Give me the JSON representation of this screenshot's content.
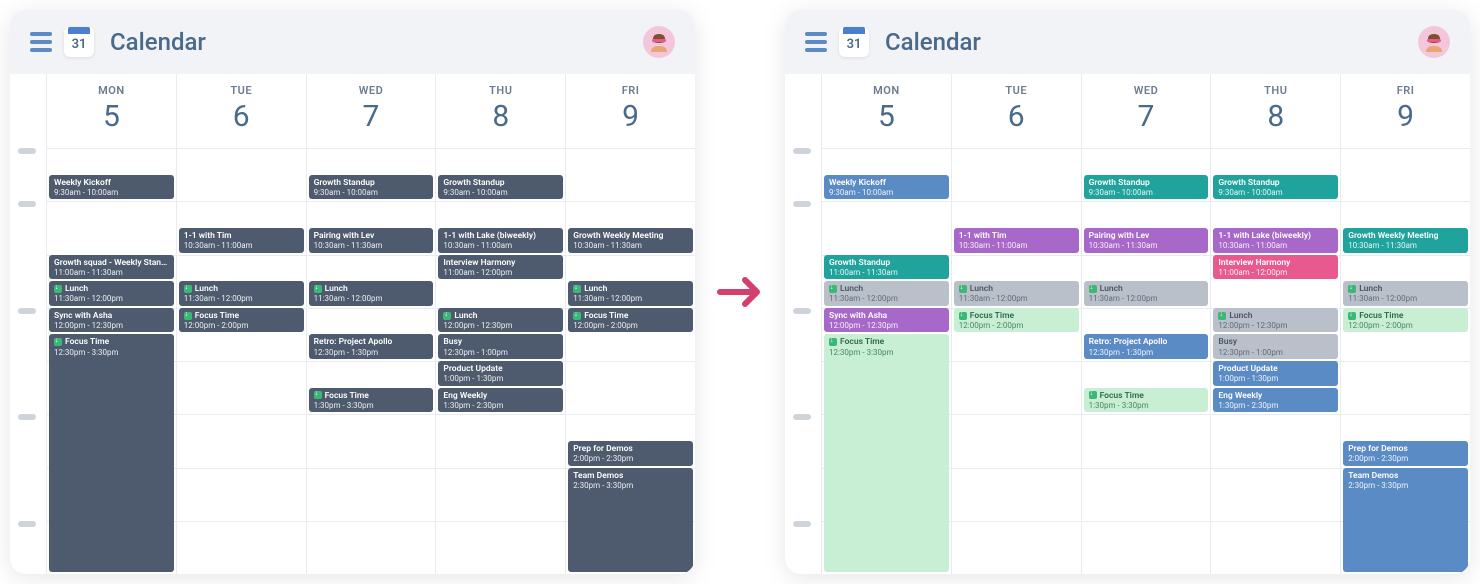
{
  "header": {
    "icon_date": "31",
    "title": "Calendar"
  },
  "days": [
    {
      "label": "MON",
      "num": "5"
    },
    {
      "label": "TUE",
      "num": "6"
    },
    {
      "label": "WED",
      "num": "7"
    },
    {
      "label": "THU",
      "num": "8"
    },
    {
      "label": "FRI",
      "num": "9"
    }
  ],
  "hour_start": 9,
  "hour_end": 17,
  "spine_hours": [
    9,
    10,
    12,
    14,
    16
  ],
  "panels": [
    {
      "name": "before",
      "events": [
        {
          "day": 0,
          "title": "Weekly Kickoff",
          "time": "9:30am - 10:00am",
          "start": 9.5,
          "end": 10.0,
          "color": "c-slate",
          "reclaim": false
        },
        {
          "day": 0,
          "title": "Growth squad - Weekly Standup",
          "time": "11:00am - 11:30am",
          "start": 11.0,
          "end": 11.5,
          "color": "c-slate",
          "reclaim": false
        },
        {
          "day": 0,
          "title": "Lunch",
          "time": "11:30am - 12:00pm",
          "start": 11.5,
          "end": 12.0,
          "color": "c-slate",
          "reclaim": true
        },
        {
          "day": 0,
          "title": "Sync with Asha",
          "time": "12:00pm - 12:30pm",
          "start": 12.0,
          "end": 12.5,
          "color": "c-slate",
          "reclaim": false
        },
        {
          "day": 0,
          "title": "Focus Time",
          "time": "12:30pm - 3:30pm",
          "start": 12.5,
          "end": 17.0,
          "color": "c-slate",
          "reclaim": true
        },
        {
          "day": 1,
          "title": "1-1 with Tim",
          "time": "10:30am - 11:00am",
          "start": 10.5,
          "end": 11.0,
          "color": "c-slate",
          "reclaim": false
        },
        {
          "day": 1,
          "title": "Lunch",
          "time": "11:30am - 12:00pm",
          "start": 11.5,
          "end": 12.0,
          "color": "c-slate",
          "reclaim": true
        },
        {
          "day": 1,
          "title": "Focus Time",
          "time": "12:00pm - 2:00pm",
          "start": 12.0,
          "end": 12.5,
          "color": "c-slate",
          "reclaim": true
        },
        {
          "day": 2,
          "title": "Growth Standup",
          "time": "9:30am - 10:00am",
          "start": 9.5,
          "end": 10.0,
          "color": "c-slate",
          "reclaim": false
        },
        {
          "day": 2,
          "title": "Pairing with Lev",
          "time": "10:30am - 11:30am",
          "start": 10.5,
          "end": 11.0,
          "color": "c-slate",
          "reclaim": false
        },
        {
          "day": 2,
          "title": "Lunch",
          "time": "11:30am - 12:00pm",
          "start": 11.5,
          "end": 12.0,
          "color": "c-slate",
          "reclaim": true
        },
        {
          "day": 2,
          "title": "Retro: Project Apollo",
          "time": "12:30pm - 1:30pm",
          "start": 12.5,
          "end": 13.0,
          "color": "c-slate",
          "reclaim": false
        },
        {
          "day": 2,
          "title": "Focus Time",
          "time": "1:30pm - 3:30pm",
          "start": 13.5,
          "end": 14.0,
          "color": "c-slate",
          "reclaim": true
        },
        {
          "day": 3,
          "title": "Growth Standup",
          "time": "9:30am - 10:00am",
          "start": 9.5,
          "end": 10.0,
          "color": "c-slate",
          "reclaim": false
        },
        {
          "day": 3,
          "title": "1-1 with Lake (biweekly)",
          "time": "10:30am - 11:00am",
          "start": 10.5,
          "end": 11.0,
          "color": "c-slate",
          "reclaim": false
        },
        {
          "day": 3,
          "title": "Interview Harmony",
          "time": "11:00am - 12:00pm",
          "start": 11.0,
          "end": 11.5,
          "color": "c-slate",
          "reclaim": false
        },
        {
          "day": 3,
          "title": "Lunch",
          "time": "12:00pm - 12:30pm",
          "start": 12.0,
          "end": 12.5,
          "color": "c-slate",
          "reclaim": true
        },
        {
          "day": 3,
          "title": "Busy",
          "time": "12:30pm - 1:00pm",
          "start": 12.5,
          "end": 13.0,
          "color": "c-slate",
          "reclaim": false
        },
        {
          "day": 3,
          "title": "Product Update",
          "time": "1:00pm - 1:30pm",
          "start": 13.0,
          "end": 13.5,
          "color": "c-slate",
          "reclaim": false
        },
        {
          "day": 3,
          "title": "Eng Weekly",
          "time": "1:30pm - 2:30pm",
          "start": 13.5,
          "end": 14.0,
          "color": "c-slate",
          "reclaim": false
        },
        {
          "day": 4,
          "title": "Growth Weekly Meeting",
          "time": "10:30am - 11:30am",
          "start": 10.5,
          "end": 11.0,
          "color": "c-slate",
          "reclaim": false
        },
        {
          "day": 4,
          "title": "Lunch",
          "time": "11:30am - 12:00pm",
          "start": 11.5,
          "end": 12.0,
          "color": "c-slate",
          "reclaim": true
        },
        {
          "day": 4,
          "title": "Focus Time",
          "time": "12:00pm - 2:00pm",
          "start": 12.0,
          "end": 12.5,
          "color": "c-slate",
          "reclaim": true
        },
        {
          "day": 4,
          "title": "Prep for Demos",
          "time": "2:00pm - 2:30pm",
          "start": 14.5,
          "end": 15.0,
          "color": "c-slate",
          "reclaim": false
        },
        {
          "day": 4,
          "title": "Team Demos",
          "time": "2:30pm - 3:30pm",
          "start": 15.0,
          "end": 17.0,
          "color": "c-slate",
          "reclaim": false
        }
      ]
    },
    {
      "name": "after",
      "events": [
        {
          "day": 0,
          "title": "Weekly Kickoff",
          "time": "9:30am - 10:00am",
          "start": 9.5,
          "end": 10.0,
          "color": "c-blue",
          "reclaim": false
        },
        {
          "day": 0,
          "title": "Growth Standup",
          "time": "11:00am - 11:30am",
          "start": 11.0,
          "end": 11.5,
          "color": "c-teal",
          "reclaim": false
        },
        {
          "day": 0,
          "title": "Lunch",
          "time": "11:30am - 12:00pm",
          "start": 11.5,
          "end": 12.0,
          "color": "c-gray",
          "reclaim": true
        },
        {
          "day": 0,
          "title": "Sync with Asha",
          "time": "12:00pm - 12:30pm",
          "start": 12.0,
          "end": 12.5,
          "color": "c-purple",
          "reclaim": false
        },
        {
          "day": 0,
          "title": "Focus Time",
          "time": "12:30pm - 3:30pm",
          "start": 12.5,
          "end": 17.0,
          "color": "c-green-light",
          "reclaim": true
        },
        {
          "day": 1,
          "title": "1-1 with Tim",
          "time": "10:30am - 11:00am",
          "start": 10.5,
          "end": 11.0,
          "color": "c-purple",
          "reclaim": false
        },
        {
          "day": 1,
          "title": "Lunch",
          "time": "11:30am - 12:00pm",
          "start": 11.5,
          "end": 12.0,
          "color": "c-gray",
          "reclaim": true
        },
        {
          "day": 1,
          "title": "Focus Time",
          "time": "12:00pm - 2:00pm",
          "start": 12.0,
          "end": 12.5,
          "color": "c-green-light",
          "reclaim": true
        },
        {
          "day": 2,
          "title": "Growth Standup",
          "time": "9:30am - 10:00am",
          "start": 9.5,
          "end": 10.0,
          "color": "c-teal",
          "reclaim": false
        },
        {
          "day": 2,
          "title": "Pairing with Lev",
          "time": "10:30am - 11:30am",
          "start": 10.5,
          "end": 11.0,
          "color": "c-purple",
          "reclaim": false
        },
        {
          "day": 2,
          "title": "Lunch",
          "time": "11:30am - 12:00pm",
          "start": 11.5,
          "end": 12.0,
          "color": "c-gray",
          "reclaim": true
        },
        {
          "day": 2,
          "title": "Retro: Project Apollo",
          "time": "12:30pm - 1:30pm",
          "start": 12.5,
          "end": 13.0,
          "color": "c-blue",
          "reclaim": false
        },
        {
          "day": 2,
          "title": "Focus Time",
          "time": "1:30pm - 3:30pm",
          "start": 13.5,
          "end": 14.0,
          "color": "c-green-light",
          "reclaim": true
        },
        {
          "day": 3,
          "title": "Growth Standup",
          "time": "9:30am - 10:00am",
          "start": 9.5,
          "end": 10.0,
          "color": "c-teal",
          "reclaim": false
        },
        {
          "day": 3,
          "title": "1-1 with Lake (biweekly)",
          "time": "10:30am - 11:00am",
          "start": 10.5,
          "end": 11.0,
          "color": "c-purple",
          "reclaim": false
        },
        {
          "day": 3,
          "title": "Interview Harmony",
          "time": "11:00am - 12:00pm",
          "start": 11.0,
          "end": 11.5,
          "color": "c-pink",
          "reclaim": false
        },
        {
          "day": 3,
          "title": "Lunch",
          "time": "12:00pm - 12:30pm",
          "start": 12.0,
          "end": 12.5,
          "color": "c-gray",
          "reclaim": true
        },
        {
          "day": 3,
          "title": "Busy",
          "time": "12:30pm - 1:00pm",
          "start": 12.5,
          "end": 13.0,
          "color": "c-gray",
          "reclaim": false
        },
        {
          "day": 3,
          "title": "Product Update",
          "time": "1:00pm - 1:30pm",
          "start": 13.0,
          "end": 13.5,
          "color": "c-blue",
          "reclaim": false
        },
        {
          "day": 3,
          "title": "Eng Weekly",
          "time": "1:30pm - 2:30pm",
          "start": 13.5,
          "end": 14.0,
          "color": "c-blue",
          "reclaim": false
        },
        {
          "day": 4,
          "title": "Growth Weekly Meeting",
          "time": "10:30am - 11:30am",
          "start": 10.5,
          "end": 11.0,
          "color": "c-teal",
          "reclaim": false
        },
        {
          "day": 4,
          "title": "Lunch",
          "time": "11:30am - 12:00pm",
          "start": 11.5,
          "end": 12.0,
          "color": "c-gray",
          "reclaim": true
        },
        {
          "day": 4,
          "title": "Focus Time",
          "time": "12:00pm - 2:00pm",
          "start": 12.0,
          "end": 12.5,
          "color": "c-green-light",
          "reclaim": true
        },
        {
          "day": 4,
          "title": "Prep for Demos",
          "time": "2:00pm - 2:30pm",
          "start": 14.5,
          "end": 15.0,
          "color": "c-blue",
          "reclaim": false
        },
        {
          "day": 4,
          "title": "Team Demos",
          "time": "2:30pm - 3:30pm",
          "start": 15.0,
          "end": 17.0,
          "color": "c-blue",
          "reclaim": false
        }
      ]
    }
  ]
}
